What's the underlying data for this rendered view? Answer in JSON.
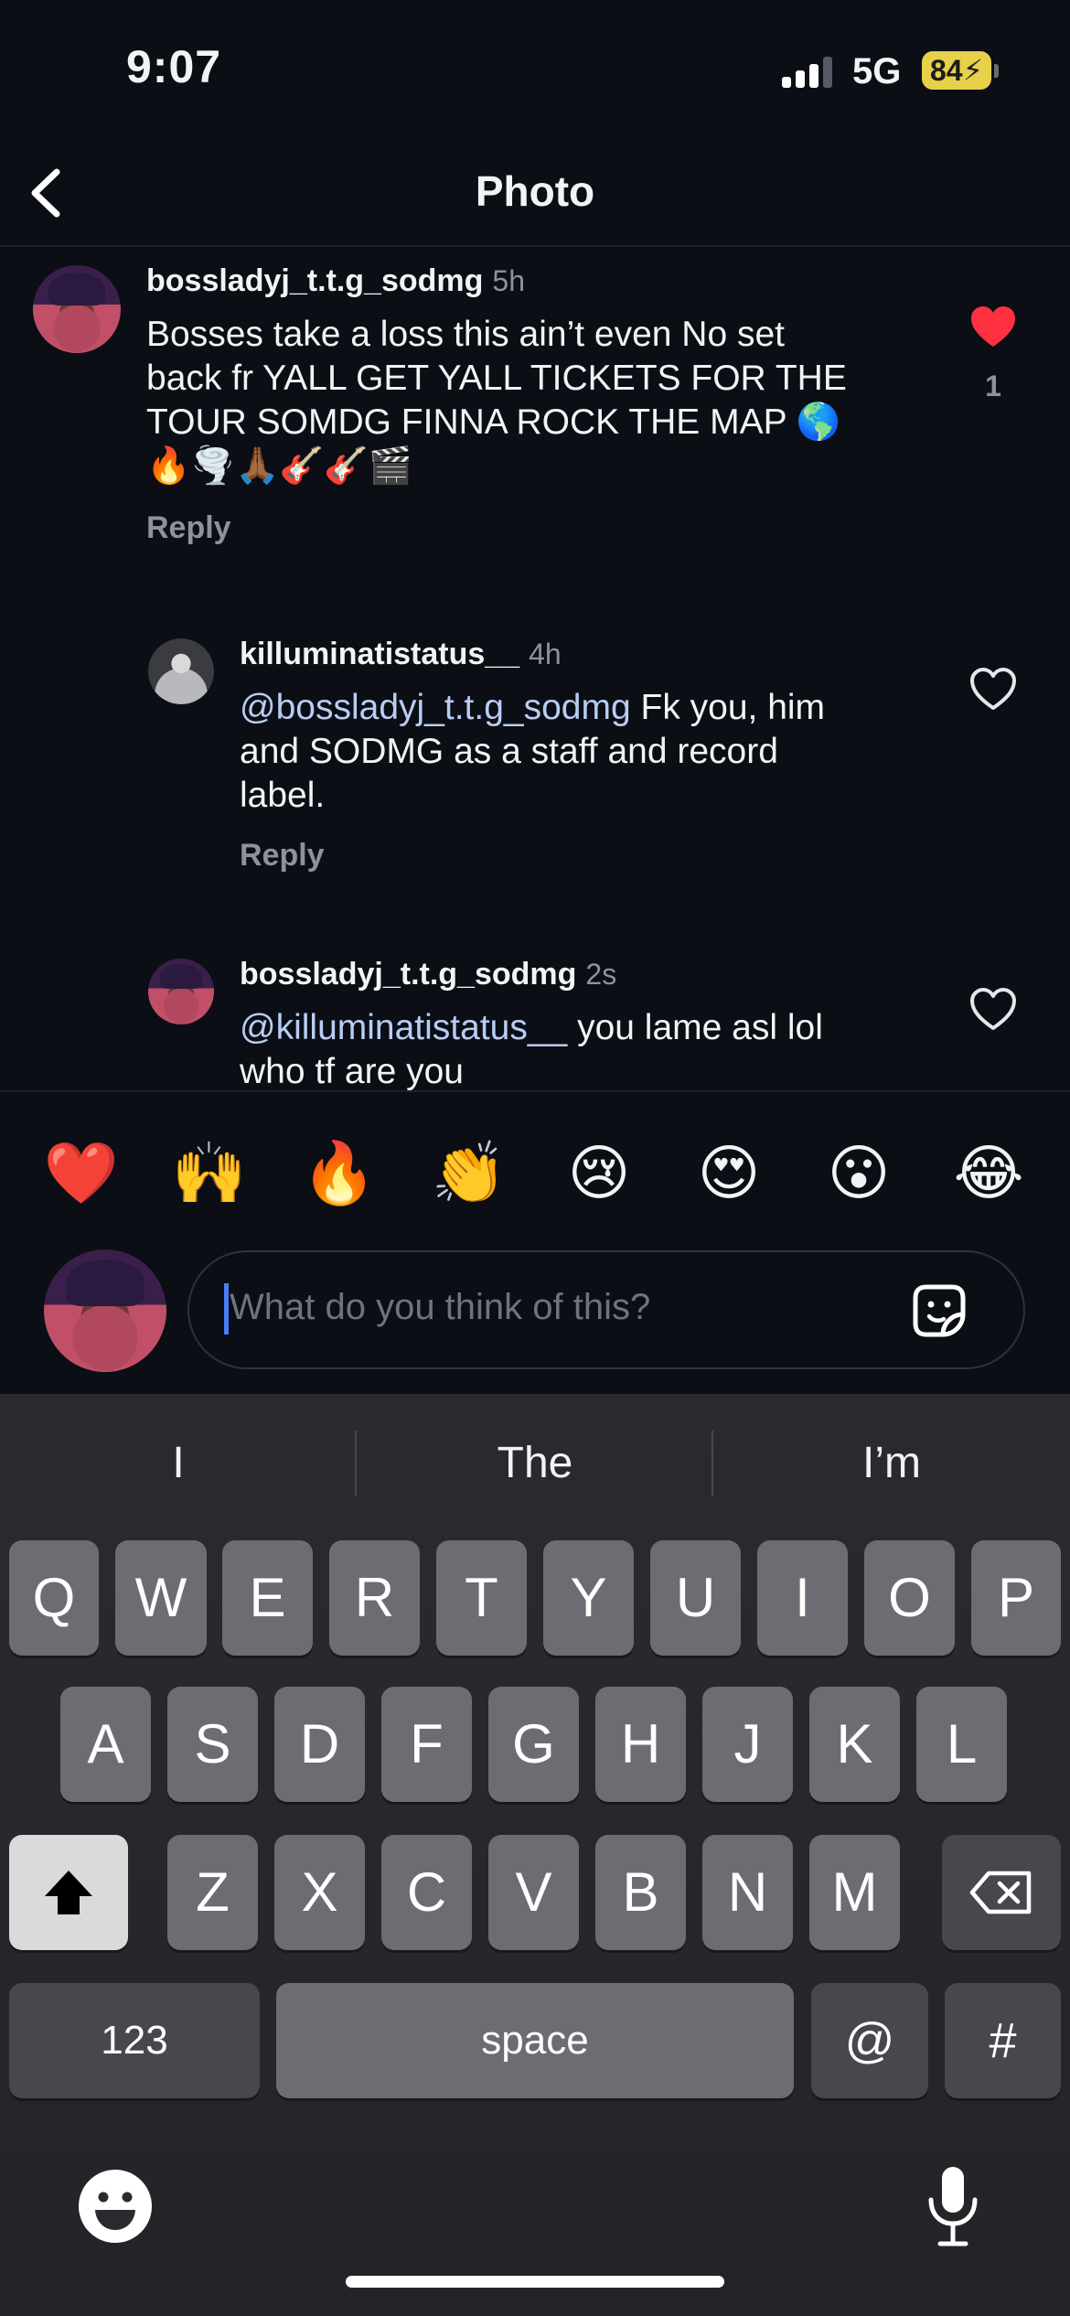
{
  "status_bar": {
    "time": "9:07",
    "network": "5G",
    "battery": "84"
  },
  "header": {
    "title": "Photo"
  },
  "comments": [
    {
      "username": "bossladyj_t.t.g_sodmg",
      "time": "5h",
      "text_lines": [
        "Bosses take a loss this ain’t even No set",
        "back fr YALL GET YALL TICKETS FOR THE",
        "TOUR SOMDG FINNA ROCK THE MAP 🌎",
        "🔥🌪️🙏🏾🎸🎸🎬"
      ],
      "reply": "Reply",
      "likes": "1",
      "liked": true
    },
    {
      "username": "killuminatistatus__",
      "time": "4h",
      "mention": "@bossladyj_t.t.g_sodmg",
      "line1_rest": " Fk you, him",
      "line2": "and SODMG as a staff and record",
      "line3": "label.",
      "reply": "Reply",
      "liked": false
    },
    {
      "username": "bossladyj_t.t.g_sodmg",
      "time": "2s",
      "mention": "@killuminatistatus__",
      "line1_rest": " you lame asl lol",
      "line2": "who tf are you",
      "liked": false
    }
  ],
  "reactions": [
    "❤️",
    "🙌",
    "🔥",
    "👏",
    "😢",
    "😍",
    "😮",
    "😂"
  ],
  "composer": {
    "placeholder": "What do you think of this?"
  },
  "keyboard": {
    "suggestions": [
      "I",
      "The",
      "I’m"
    ],
    "row1": [
      "Q",
      "W",
      "E",
      "R",
      "T",
      "Y",
      "U",
      "I",
      "O",
      "P"
    ],
    "row2": [
      "A",
      "S",
      "D",
      "F",
      "G",
      "H",
      "J",
      "K",
      "L"
    ],
    "row3": [
      "Z",
      "X",
      "C",
      "V",
      "B",
      "N",
      "M"
    ],
    "numbers_label": "123",
    "space_label": "space",
    "at_label": "@",
    "hash_label": "#"
  },
  "colors": {
    "like_red": "#ff3040",
    "mention_blue": "#b9cdf3",
    "background": "#0b0e14"
  }
}
